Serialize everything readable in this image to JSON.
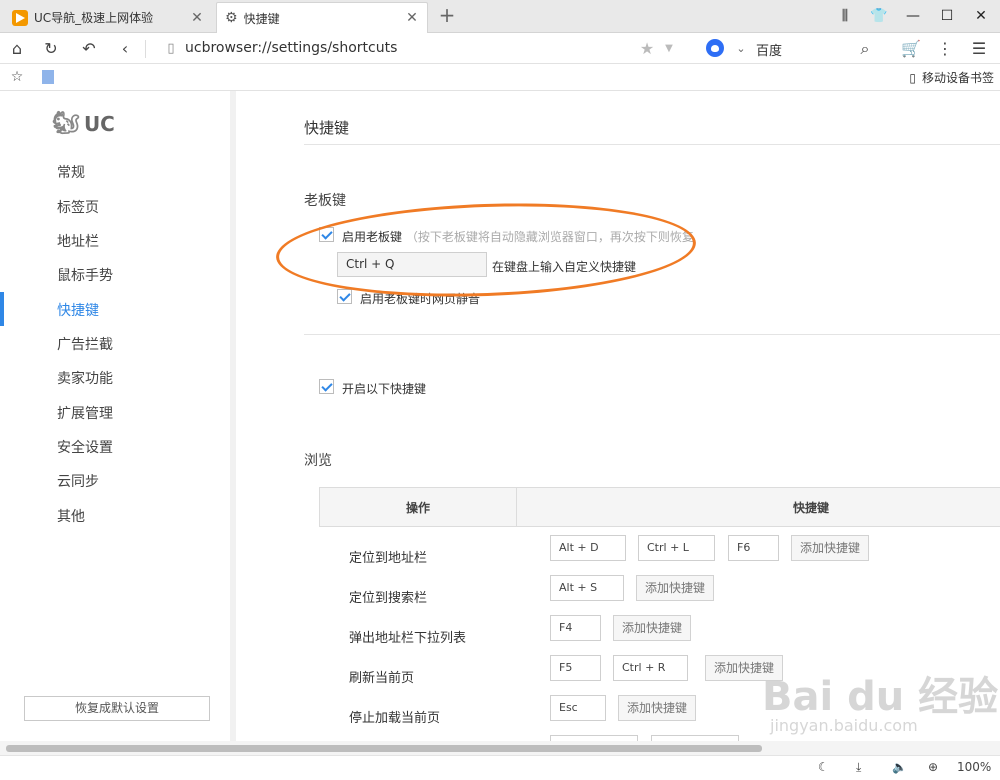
{
  "tabs": [
    {
      "title": "UC导航_极速上网体验",
      "active": false
    },
    {
      "title": "快捷键",
      "active": true
    }
  ],
  "address": {
    "url": "ucbrowser://settings/shortcuts",
    "search_engine": "百度"
  },
  "bookmarks": {
    "mobile_bookmarks": "移动设备书签"
  },
  "sidebar": {
    "logo_text": "UC",
    "items": [
      {
        "label": "常规"
      },
      {
        "label": "标签页"
      },
      {
        "label": "地址栏"
      },
      {
        "label": "鼠标手势"
      },
      {
        "label": "快捷键",
        "active": true
      },
      {
        "label": "广告拦截"
      },
      {
        "label": "卖家功能"
      },
      {
        "label": "扩展管理"
      },
      {
        "label": "安全设置"
      },
      {
        "label": "云同步"
      },
      {
        "label": "其他"
      }
    ],
    "reset_button": "恢复成默认设置"
  },
  "main": {
    "title": "快捷键",
    "boss_key": {
      "section_title": "老板键",
      "enable_label": "启用老板键",
      "enable_hint": "（按下老板键将自动隐藏浏览器窗口，再次按下则恢复",
      "enabled": true,
      "key_value": "Ctrl + Q",
      "key_hint": "在键盘上输入自定义快捷键",
      "mute_label": "启用老板键时网页静音",
      "mute_enabled": true
    },
    "enable_shortcuts_label": "开启以下快捷键",
    "enable_shortcuts": true,
    "browse_section_title": "浏览",
    "table": {
      "col_action": "操作",
      "col_shortcut": "快捷键",
      "add_label": "添加快捷键",
      "rows": [
        {
          "action": "定位到地址栏",
          "keys": [
            "Alt + D",
            "Ctrl + L",
            "F6"
          ]
        },
        {
          "action": "定位到搜索栏",
          "keys": [
            "Alt + S"
          ]
        },
        {
          "action": "弹出地址栏下拉列表",
          "keys": [
            "F4"
          ]
        },
        {
          "action": "刷新当前页",
          "keys": [
            "F5",
            "Ctrl + R"
          ]
        },
        {
          "action": "停止加载当前页",
          "keys": [
            "Esc"
          ]
        }
      ]
    }
  },
  "status": {
    "zoom": "100%"
  },
  "watermark": {
    "text": "Bai du 经验",
    "sub": "jingyan.baidu.com"
  },
  "colors": {
    "accent": "#2f87e6",
    "annotation": "#f07b25",
    "brand_orange": "#f39800"
  }
}
